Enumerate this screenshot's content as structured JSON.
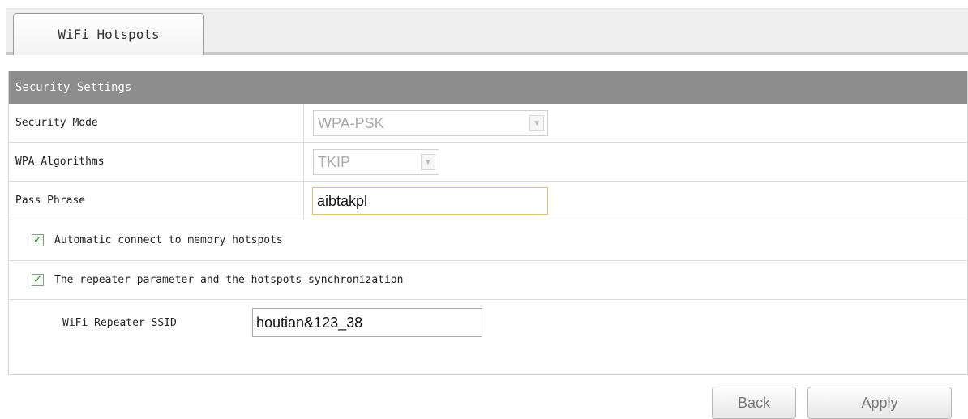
{
  "tabs": [
    {
      "label": "WiFi Hotspots",
      "active": true
    }
  ],
  "section": {
    "title": "Security Settings"
  },
  "fields": {
    "security_mode": {
      "label": "Security Mode",
      "value": "WPA-PSK"
    },
    "wpa_algorithms": {
      "label": "WPA Algorithms",
      "value": "TKIP"
    },
    "pass_phrase": {
      "label": "Pass Phrase",
      "value": "aibtakpl"
    }
  },
  "checkboxes": [
    {
      "label": "Automatic connect to memory hotspots",
      "checked": true
    },
    {
      "label": "The repeater parameter and the hotspots synchronization",
      "checked": true
    }
  ],
  "repeater": {
    "label": "WiFi Repeater SSID",
    "value": "houtian&123_38"
  },
  "buttons": {
    "back": "Back",
    "apply": "Apply"
  },
  "icons": {
    "dropdown": "chevron-down-icon",
    "checkbox": "checkmark-icon"
  },
  "colors": {
    "header_bg": "#8d8d8d",
    "check": "#2d8a2d",
    "focus_border": "#d9c27a"
  }
}
